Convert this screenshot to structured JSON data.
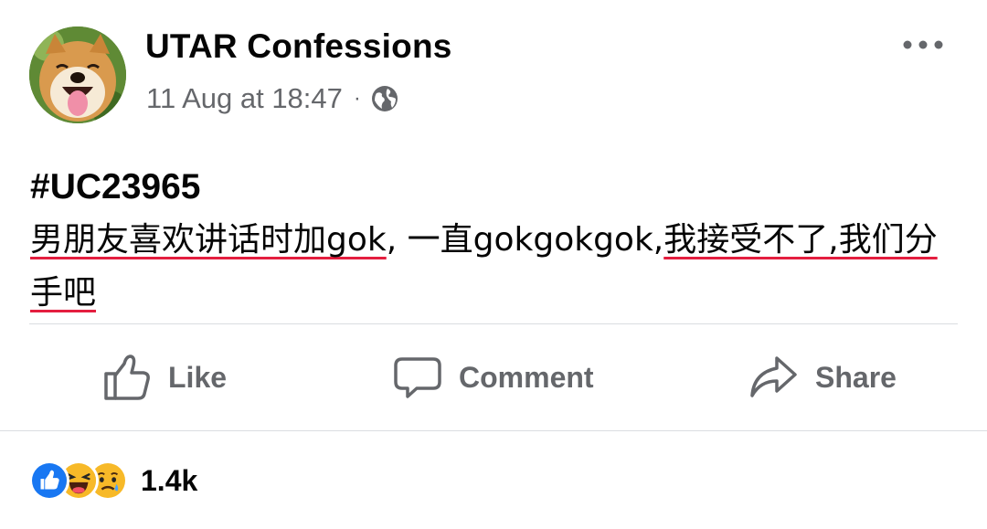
{
  "post": {
    "page_name": "UTAR Confessions",
    "date": "11 Aug at 18:47",
    "separator": "·",
    "audience_icon": "globe-icon",
    "more_icon": "more-dots-icon",
    "hashtag": "#UC23965",
    "text_part1": "男朋友喜欢讲话时加gok",
    "text_part2": ", 一直gokgokgok,",
    "text_part3": "我接受不了,我们分手吧"
  },
  "actions": {
    "like_label": "Like",
    "comment_label": "Comment",
    "share_label": "Share"
  },
  "reactions": {
    "icons": [
      "like-reaction-icon",
      "haha-reaction-icon",
      "sad-reaction-icon"
    ],
    "count": "1.4k"
  },
  "colors": {
    "text_primary": "#050505",
    "text_secondary": "#65676b",
    "divider": "#dadde1",
    "underline": "#e41e3f",
    "like_blue": "#1877f2"
  }
}
